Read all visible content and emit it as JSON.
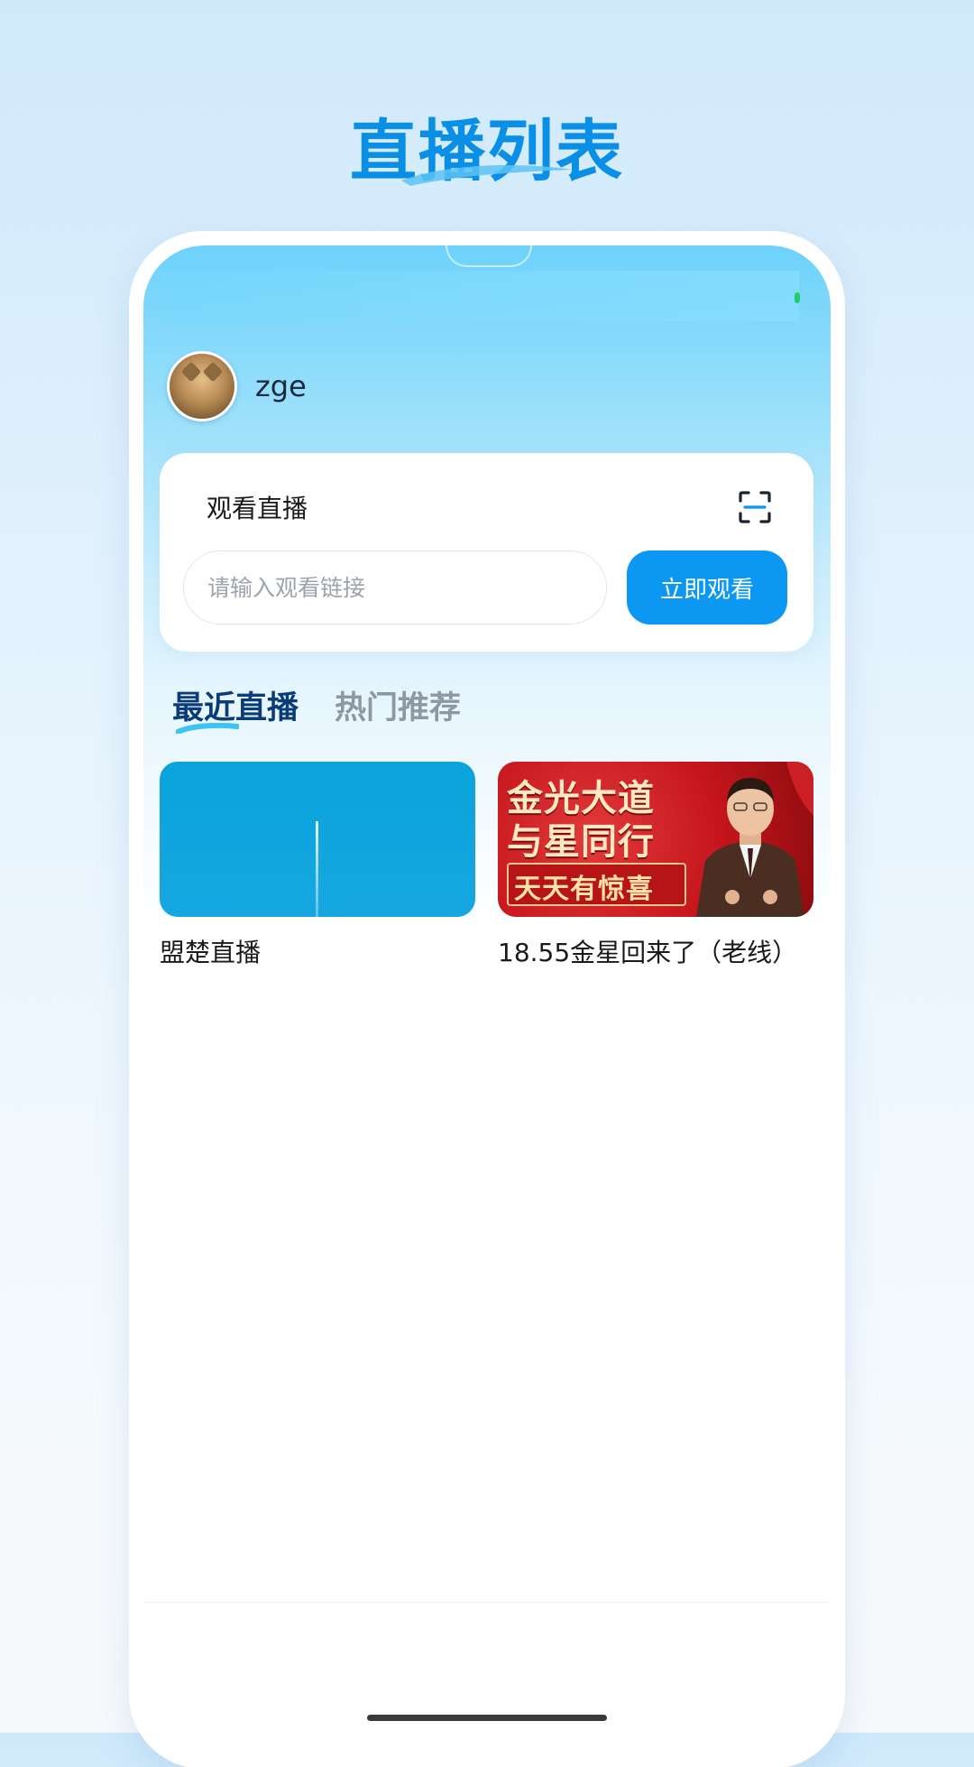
{
  "promo": {
    "title": "直播列表"
  },
  "user": {
    "name": "zge"
  },
  "watch": {
    "title": "观看直播",
    "input_placeholder": "请输入观看链接",
    "button_label": "立即观看"
  },
  "tabs": {
    "active": "最近直播",
    "other": "热门推荐"
  },
  "lives": [
    {
      "title": "盟楚直播"
    },
    {
      "title": "18.55金星回来了（老线）",
      "thumb_text": [
        "金光大道",
        "与星同行",
        "天天有惊喜"
      ]
    }
  ],
  "colors": {
    "accent": "#0b97f2",
    "active_tab": "#0a3c78",
    "inactive_tab": "#8d98a4"
  }
}
